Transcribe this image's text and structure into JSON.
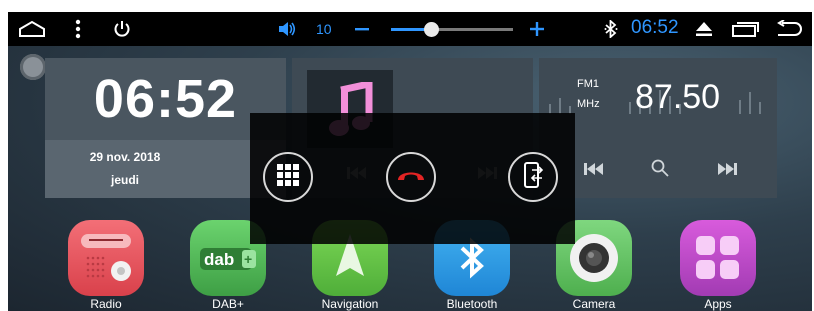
{
  "status_bar": {
    "volume_value": "10",
    "volume_level": 0.33,
    "time": "06:52",
    "icons": [
      "home-icon",
      "more-vert-icon",
      "power-icon",
      "volume-icon",
      "volume-minus-icon",
      "volume-plus-icon",
      "bluetooth-icon",
      "eject-icon",
      "recent-apps-icon",
      "back-icon"
    ],
    "accent_color": "#2f96ff"
  },
  "clock_widget": {
    "time_hours": "06",
    "time_minutes": "52",
    "date": "29 nov. 2018",
    "weekday": "jeudi"
  },
  "music_widget": {
    "icons": [
      "music-note-icon",
      "prev-icon",
      "next-icon"
    ]
  },
  "radio_widget": {
    "band": "FM1",
    "unit": "MHz",
    "frequency": "87.50"
  },
  "call_overlay": {
    "buttons": [
      "keypad-icon",
      "hang-up-icon",
      "phone-transfer-icon"
    ]
  },
  "apps": [
    {
      "label": "Radio"
    },
    {
      "label": "DAB+",
      "icon_text": "dab"
    },
    {
      "label": "Navigation"
    },
    {
      "label": "Bluetooth"
    },
    {
      "label": "Camera"
    },
    {
      "label": "Apps"
    }
  ]
}
